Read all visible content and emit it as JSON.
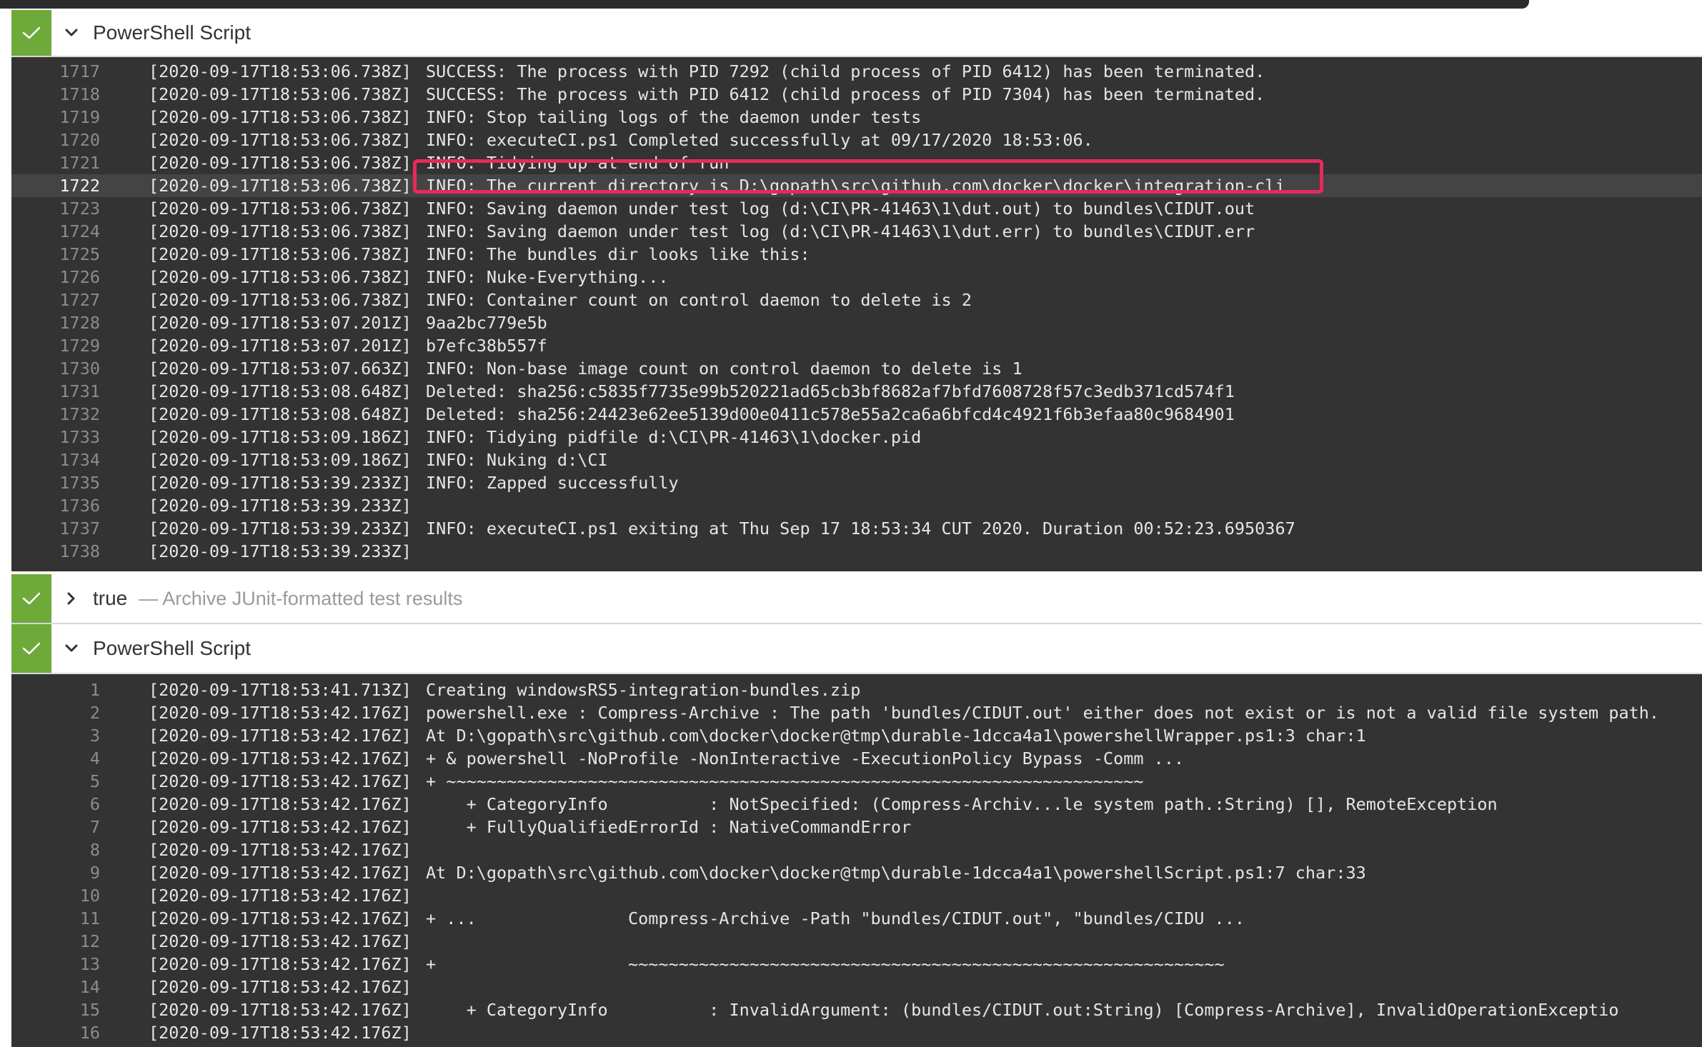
{
  "colors": {
    "success_green": "#6daa3a",
    "console_bg": "#333333",
    "highlight_border": "#e8295b"
  },
  "steps": [
    {
      "status_icon": "check-icon",
      "toggle_icon": "chevron-down-icon",
      "title": "PowerShell Script",
      "description": "",
      "expanded": true
    },
    {
      "status_icon": "check-icon",
      "toggle_icon": "chevron-right-icon",
      "title": "true",
      "description": "— Archive JUnit-formatted test results",
      "expanded": false
    },
    {
      "status_icon": "check-icon",
      "toggle_icon": "chevron-down-icon",
      "title": "PowerShell Script",
      "description": "",
      "expanded": true
    }
  ],
  "console1": {
    "highlighted_line": "1722",
    "lines": [
      {
        "n": "1717",
        "ts": "[2020-09-17T18:53:06.738Z]",
        "msg": "SUCCESS: The process with PID 7292 (child process of PID 6412) has been terminated."
      },
      {
        "n": "1718",
        "ts": "[2020-09-17T18:53:06.738Z]",
        "msg": "SUCCESS: The process with PID 6412 (child process of PID 7304) has been terminated."
      },
      {
        "n": "1719",
        "ts": "[2020-09-17T18:53:06.738Z]",
        "msg": "INFO: Stop tailing logs of the daemon under tests"
      },
      {
        "n": "1720",
        "ts": "[2020-09-17T18:53:06.738Z]",
        "msg": "INFO: executeCI.ps1 Completed successfully at 09/17/2020 18:53:06."
      },
      {
        "n": "1721",
        "ts": "[2020-09-17T18:53:06.738Z]",
        "msg": "INFO: Tidying up at end of run"
      },
      {
        "n": "1722",
        "ts": "[2020-09-17T18:53:06.738Z]",
        "msg": "INFO: The current directory is D:\\gopath\\src\\github.com\\docker\\docker\\integration-cli"
      },
      {
        "n": "1723",
        "ts": "[2020-09-17T18:53:06.738Z]",
        "msg": "INFO: Saving daemon under test log (d:\\CI\\PR-41463\\1\\dut.out) to bundles\\CIDUT.out"
      },
      {
        "n": "1724",
        "ts": "[2020-09-17T18:53:06.738Z]",
        "msg": "INFO: Saving daemon under test log (d:\\CI\\PR-41463\\1\\dut.err) to bundles\\CIDUT.err"
      },
      {
        "n": "1725",
        "ts": "[2020-09-17T18:53:06.738Z]",
        "msg": "INFO: The bundles dir looks like this:"
      },
      {
        "n": "1726",
        "ts": "[2020-09-17T18:53:06.738Z]",
        "msg": "INFO: Nuke-Everything..."
      },
      {
        "n": "1727",
        "ts": "[2020-09-17T18:53:06.738Z]",
        "msg": "INFO: Container count on control daemon to delete is 2"
      },
      {
        "n": "1728",
        "ts": "[2020-09-17T18:53:07.201Z]",
        "msg": "9aa2bc779e5b"
      },
      {
        "n": "1729",
        "ts": "[2020-09-17T18:53:07.201Z]",
        "msg": "b7efc38b557f"
      },
      {
        "n": "1730",
        "ts": "[2020-09-17T18:53:07.663Z]",
        "msg": "INFO: Non-base image count on control daemon to delete is 1"
      },
      {
        "n": "1731",
        "ts": "[2020-09-17T18:53:08.648Z]",
        "msg": "Deleted: sha256:c5835f7735e99b520221ad65cb3bf8682af7bfd7608728f57c3edb371cd574f1"
      },
      {
        "n": "1732",
        "ts": "[2020-09-17T18:53:08.648Z]",
        "msg": "Deleted: sha256:24423e62ee5139d00e0411c578e55a2ca6a6bfcd4c4921f6b3efaa80c9684901"
      },
      {
        "n": "1733",
        "ts": "[2020-09-17T18:53:09.186Z]",
        "msg": "INFO: Tidying pidfile d:\\CI\\PR-41463\\1\\docker.pid"
      },
      {
        "n": "1734",
        "ts": "[2020-09-17T18:53:09.186Z]",
        "msg": "INFO: Nuking d:\\CI"
      },
      {
        "n": "1735",
        "ts": "[2020-09-17T18:53:39.233Z]",
        "msg": "INFO: Zapped successfully"
      },
      {
        "n": "1736",
        "ts": "[2020-09-17T18:53:39.233Z]",
        "msg": ""
      },
      {
        "n": "1737",
        "ts": "[2020-09-17T18:53:39.233Z]",
        "msg": "INFO: executeCI.ps1 exiting at Thu Sep 17 18:53:34 CUT 2020. Duration 00:52:23.6950367"
      },
      {
        "n": "1738",
        "ts": "[2020-09-17T18:53:39.233Z]",
        "msg": ""
      }
    ]
  },
  "console2": {
    "lines": [
      {
        "n": "1",
        "ts": "[2020-09-17T18:53:41.713Z]",
        "msg": "Creating windowsRS5-integration-bundles.zip"
      },
      {
        "n": "2",
        "ts": "[2020-09-17T18:53:42.176Z]",
        "msg": "powershell.exe : Compress-Archive : The path 'bundles/CIDUT.out' either does not exist or is not a valid file system path."
      },
      {
        "n": "3",
        "ts": "[2020-09-17T18:53:42.176Z]",
        "msg": "At D:\\gopath\\src\\github.com\\docker\\docker@tmp\\durable-1dcca4a1\\powershellWrapper.ps1:3 char:1"
      },
      {
        "n": "4",
        "ts": "[2020-09-17T18:53:42.176Z]",
        "msg": "+ & powershell -NoProfile -NonInteractive -ExecutionPolicy Bypass -Comm ..."
      },
      {
        "n": "5",
        "ts": "[2020-09-17T18:53:42.176Z]",
        "msg": "+ ~~~~~~~~~~~~~~~~~~~~~~~~~~~~~~~~~~~~~~~~~~~~~~~~~~~~~~~~~~~~~~~~~~~~~"
      },
      {
        "n": "6",
        "ts": "[2020-09-17T18:53:42.176Z]",
        "msg": "    + CategoryInfo          : NotSpecified: (Compress-Archiv...le system path.:String) [], RemoteException"
      },
      {
        "n": "7",
        "ts": "[2020-09-17T18:53:42.176Z]",
        "msg": "    + FullyQualifiedErrorId : NativeCommandError"
      },
      {
        "n": "8",
        "ts": "[2020-09-17T18:53:42.176Z]",
        "msg": ""
      },
      {
        "n": "9",
        "ts": "[2020-09-17T18:53:42.176Z]",
        "msg": "At D:\\gopath\\src\\github.com\\docker\\docker@tmp\\durable-1dcca4a1\\powershellScript.ps1:7 char:33"
      },
      {
        "n": "10",
        "ts": "[2020-09-17T18:53:42.176Z]",
        "msg": ""
      },
      {
        "n": "11",
        "ts": "[2020-09-17T18:53:42.176Z]",
        "msg": "+ ...               Compress-Archive -Path \"bundles/CIDUT.out\", \"bundles/CIDU ..."
      },
      {
        "n": "12",
        "ts": "[2020-09-17T18:53:42.176Z]",
        "msg": ""
      },
      {
        "n": "13",
        "ts": "[2020-09-17T18:53:42.176Z]",
        "msg": "+                   ~~~~~~~~~~~~~~~~~~~~~~~~~~~~~~~~~~~~~~~~~~~~~~~~~~~~~~~~~~~"
      },
      {
        "n": "14",
        "ts": "[2020-09-17T18:53:42.176Z]",
        "msg": ""
      },
      {
        "n": "15",
        "ts": "[2020-09-17T18:53:42.176Z]",
        "msg": "    + CategoryInfo          : InvalidArgument: (bundles/CIDUT.out:String) [Compress-Archive], InvalidOperationExceptio"
      },
      {
        "n": "16",
        "ts": "[2020-09-17T18:53:42.176Z]",
        "msg": ""
      }
    ]
  }
}
